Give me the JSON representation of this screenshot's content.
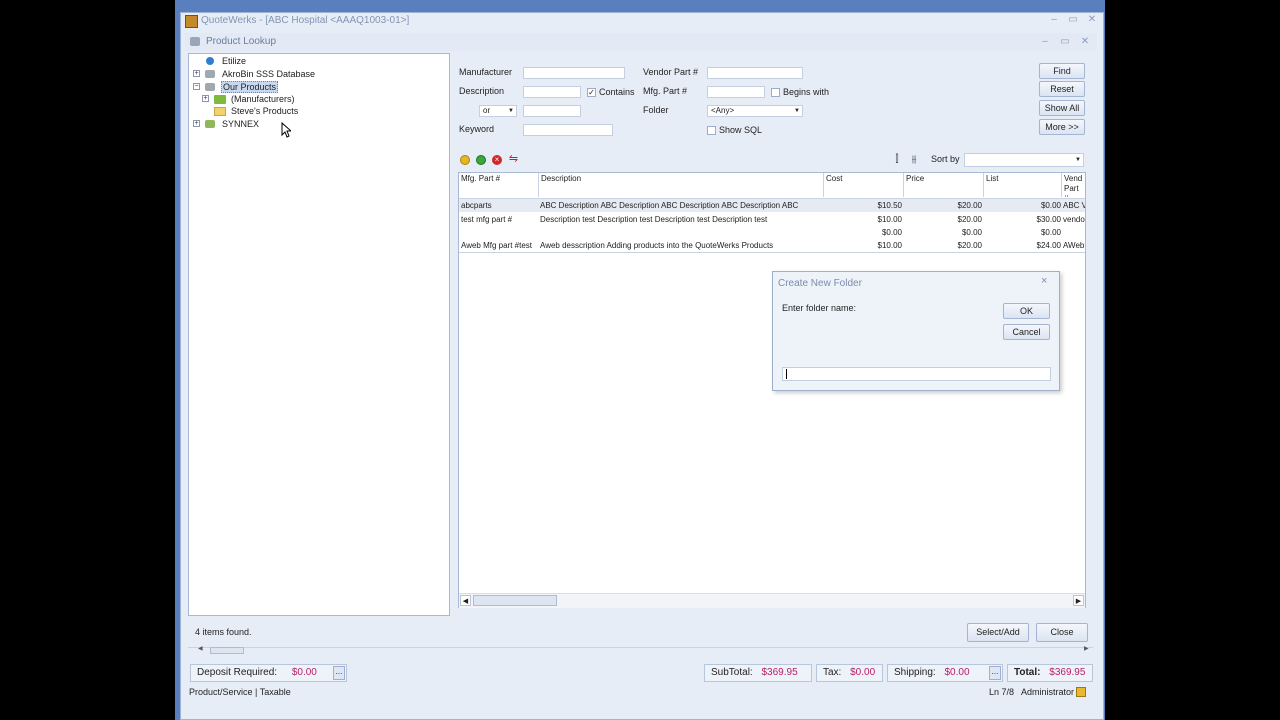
{
  "app": {
    "title": "QuoteWerks - [ABC Hospital <AAAQ1003-01>]",
    "window_controls": [
      "–",
      "▭",
      "✕"
    ]
  },
  "dialog": {
    "title": "Product Lookup",
    "controls": [
      "–",
      "▭",
      "✕"
    ]
  },
  "tree": {
    "items": [
      {
        "label": "Etilize",
        "expander": ""
      },
      {
        "label": "AkroBin SSS Database",
        "expander": "+"
      },
      {
        "label": "Our Products",
        "expander": "−"
      },
      {
        "label": "(Manufacturers)",
        "expander": "+"
      },
      {
        "label": "Steve's Products",
        "expander": ""
      },
      {
        "label": "SYNNEX",
        "expander": "+"
      }
    ]
  },
  "search": {
    "manufacturer_label": "Manufacturer",
    "manufacturer_value": "",
    "description_label": "Description",
    "description_value": "",
    "contains_label": "Contains",
    "contains_checked": "✓",
    "or_value": "or",
    "or_value2": "",
    "keyword_label": "Keyword",
    "keyword_value": "",
    "vendor_part_label": "Vendor Part #",
    "vendor_part_value": "",
    "mfg_part_label": "Mfg. Part #",
    "mfg_part_value": "",
    "begins_with_label": "Begins with",
    "folder_label": "Folder",
    "folder_value": "<Any>",
    "show_sql_label": "Show SQL",
    "find_button": "Find",
    "reset_button": "Reset",
    "show_all_button": "Show All",
    "more_button": "More >>"
  },
  "results": {
    "sort_by_label": "Sort by",
    "sort_by_value": "",
    "columns": [
      "Mfg. Part #",
      "Description",
      "Cost",
      "Price",
      "List",
      "Vend Part #"
    ],
    "rows": [
      {
        "mfg": "abcparts",
        "desc": "ABC Description ABC Description ABC Description ABC Description ABC",
        "cost": "$10.50",
        "price": "$20.00",
        "list": "$0.00",
        "vend": "ABC V"
      },
      {
        "mfg": "test mfg part #",
        "desc": "Description test Description test Description test Description test",
        "cost": "$10.00",
        "price": "$20.00",
        "list": "$30.00",
        "vend": "vendo"
      },
      {
        "mfg": "",
        "desc": "",
        "cost": "$0.00",
        "price": "$0.00",
        "list": "$0.00",
        "vend": ""
      },
      {
        "mfg": "Aweb Mfg part #test",
        "desc": "Aweb desscription Adding products into the QuoteWerks Products",
        "cost": "$10.00",
        "price": "$20.00",
        "list": "$24.00",
        "vend": "AWeb"
      }
    ],
    "items_found": "4 items found.",
    "select_add_button": "Select/Add",
    "close_button": "Close"
  },
  "modal": {
    "title": "Create New Folder",
    "prompt": "Enter folder name:",
    "ok_button": "OK",
    "cancel_button": "Cancel",
    "input_value": ""
  },
  "footer": {
    "deposit_label": "Deposit Required:",
    "deposit_value": "$0.00",
    "subtotal_label": "SubTotal:",
    "subtotal_value": "$369.95",
    "tax_label": "Tax:",
    "tax_value": "$0.00",
    "shipping_label": "Shipping:",
    "shipping_value": "$0.00",
    "total_label": "Total:",
    "total_value": "$369.95",
    "status_left": "Product/Service | Taxable",
    "status_pos": "Ln 7/8",
    "status_user": "Administrator",
    "ellipsis": "..."
  },
  "colors": {
    "accent": "#5a7fbf",
    "money": "#b8206a",
    "selection": "#c8d8f0"
  }
}
